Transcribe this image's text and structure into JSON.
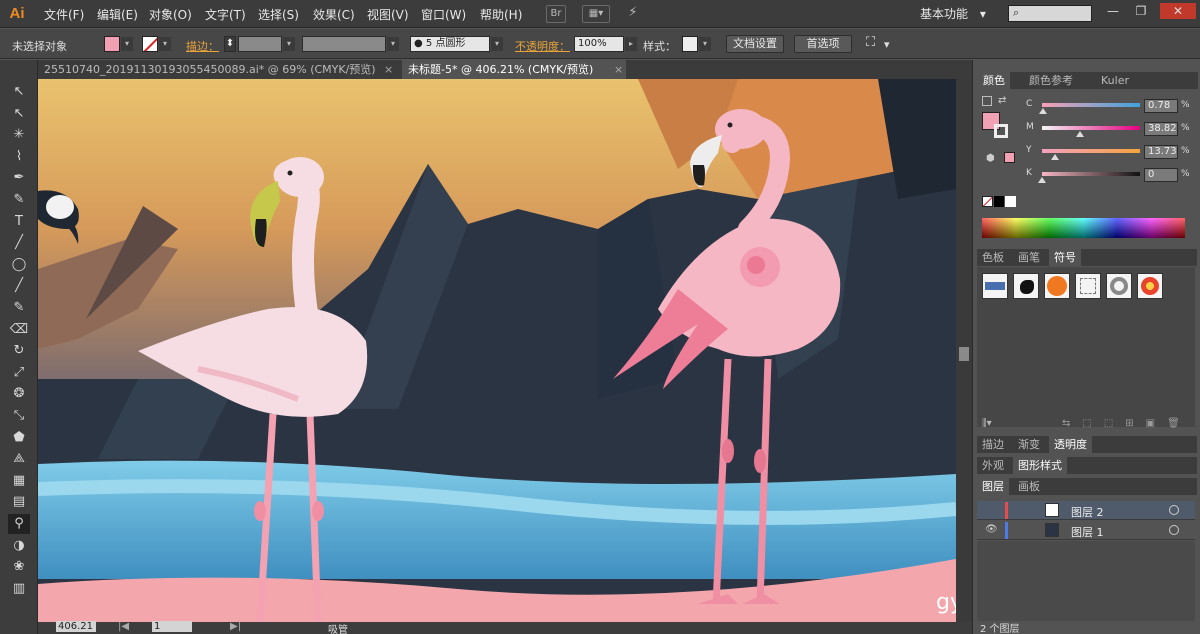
{
  "app": {
    "logo": "Ai"
  },
  "menu": {
    "items": [
      "文件(F)",
      "编辑(E)",
      "对象(O)",
      "文字(T)",
      "选择(S)",
      "效果(C)",
      "视图(V)",
      "窗口(W)",
      "帮助(H)"
    ],
    "bridge_label": "Br",
    "workspace": "基本功能",
    "workspace_arrow": "▾",
    "search_icon": "⌕"
  },
  "window_controls": {
    "minimize": "—",
    "restore": "❐",
    "close": "✕"
  },
  "control_bar": {
    "selection_status": "未选择对象",
    "stroke_label": "描边：",
    "stroke_spinner": "⬍",
    "brush_value": "● 5 点圆形",
    "opacity_label": "不透明度：",
    "opacity_value": "100%",
    "style_label": "样式：",
    "doc_settings": "文档设置",
    "preferences": "首选项",
    "arrange_icon": "⛶",
    "fill_color": "#f2a0b4"
  },
  "tabs": [
    {
      "label": "25510740_20191130193055450089.ai* @ 69% (CMYK/预览)",
      "close": "×"
    },
    {
      "label": "未标题-5* @ 406.21% (CMYK/预览)",
      "close": "×"
    }
  ],
  "tools": [
    "selection-tool",
    "direct-selection-tool",
    "magic-wand-tool",
    "lasso-tool",
    "pen-tool",
    "curvature-tool",
    "type-tool",
    "line-tool",
    "ellipse-tool",
    "paintbrush-tool",
    "pencil-tool",
    "eraser-tool",
    "rotate-tool",
    "scale-tool",
    "warp-tool",
    "free-transform-tool",
    "shape-builder-tool",
    "perspective-tool",
    "mesh-tool",
    "gradient-tool",
    "eyedropper-tool",
    "blend-tool",
    "symbol-sprayer-tool",
    "graph-tool"
  ],
  "tool_glyphs": [
    "↖",
    "↖",
    "✳",
    "⌇",
    "✒",
    "✎",
    "T",
    "╱",
    "◯",
    "╱",
    "✎",
    "⌫",
    "↻",
    "⤢",
    "❂",
    "⤡",
    "⬟",
    "⟁",
    "▦",
    "▤",
    "⚲",
    "◑",
    "❀",
    "▥"
  ],
  "status_bar": {
    "zoom": "406.21",
    "page": "1",
    "tool_name": "吸管",
    "nav_prev": "|◀",
    "nav_next": "▶|"
  },
  "color_panel": {
    "tabs": [
      "颜色",
      "颜色参考",
      "Kuler"
    ],
    "channels": [
      {
        "name": "C",
        "value": "0.78",
        "level": 0.0078,
        "gradient": "linear-gradient(90deg,#f6a0b6,#3fa3dc)"
      },
      {
        "name": "M",
        "value": "38.82",
        "level": 0.3882,
        "gradient": "linear-gradient(90deg,#f4f4f4,#e5007f)"
      },
      {
        "name": "Y",
        "value": "13.73",
        "level": 0.1373,
        "gradient": "linear-gradient(90deg,#f4a0c0,#f6a33c)"
      },
      {
        "name": "K",
        "value": "0",
        "level": 0,
        "gradient": "linear-gradient(90deg,#f6b6c2,#111)"
      }
    ],
    "pct": "%",
    "fill_color": "#f2a0b4"
  },
  "swatch_panel": {
    "tabs": [
      "色板",
      "画笔",
      "符号"
    ],
    "symbols": [
      "blue-banner-symbol",
      "ink-splat-symbol",
      "orange-button-symbol",
      "frame-symbol",
      "ring-symbol",
      "flower-symbol"
    ]
  },
  "appearance_panel": {
    "tabs": [
      "描边",
      "渐变",
      "透明度"
    ]
  },
  "style_panel": {
    "tabs": [
      "外观",
      "图形样式"
    ]
  },
  "layers_panel": {
    "tabs": [
      "图层",
      "画板"
    ],
    "layers": [
      {
        "name": "图层 2",
        "color": "#e84b4b"
      },
      {
        "name": "图层 1",
        "color": "#4b7be8"
      }
    ],
    "footer": "2 个图层"
  },
  "colors": {
    "sky_top": "#e8b96a",
    "mountain_dark": "#2b3443",
    "water": "#5fb0d6",
    "flamingo_light": "#f5d4dc",
    "flamingo_pink": "#f39bb0",
    "sand": "#f4a6ad"
  }
}
